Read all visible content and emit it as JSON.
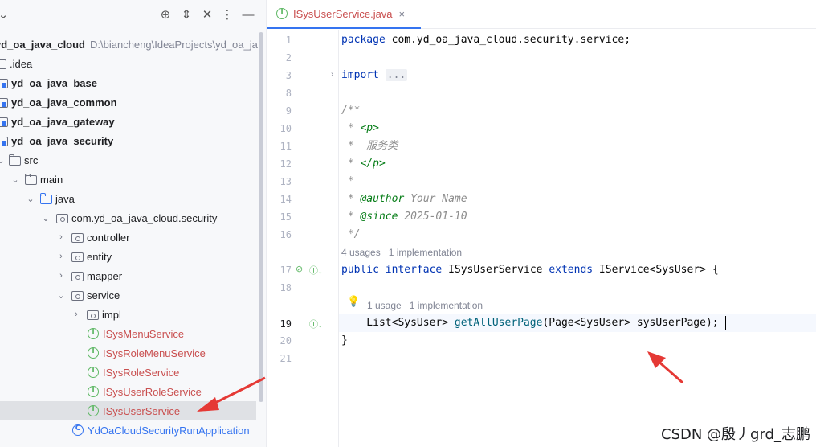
{
  "project_panel": {
    "toolbar_icons": [
      "locate-icon",
      "expand-collapse-icon",
      "collapse-all-icon",
      "more-icon",
      "minimize-icon"
    ],
    "root": {
      "name": "yd_oa_java_cloud",
      "path": "D:\\biancheng\\IdeaProjects\\yd_oa_ja"
    },
    "items": [
      {
        "label": ".idea"
      },
      {
        "label": "yd_oa_java_base"
      },
      {
        "label": "yd_oa_java_common"
      },
      {
        "label": "yd_oa_java_gateway"
      },
      {
        "label": "yd_oa_java_security"
      },
      {
        "label": "src"
      },
      {
        "label": "main"
      },
      {
        "label": "java"
      },
      {
        "label": "com.yd_oa_java_cloud.security"
      },
      {
        "label": "controller"
      },
      {
        "label": "entity"
      },
      {
        "label": "mapper"
      },
      {
        "label": "service"
      },
      {
        "label": "impl"
      },
      {
        "label": "ISysMenuService"
      },
      {
        "label": "ISysRoleMenuService"
      },
      {
        "label": "ISysRoleService"
      },
      {
        "label": "ISysUserRoleService"
      },
      {
        "label": "ISysUserService"
      },
      {
        "label": "YdOaCloudSecurityRunApplication"
      }
    ]
  },
  "editor": {
    "tab": {
      "label": "ISysUserService.java",
      "close": "×"
    },
    "line_numbers": [
      "1",
      "2",
      "3",
      "8",
      "9",
      "10",
      "11",
      "12",
      "13",
      "14",
      "15",
      "16",
      "17",
      "18",
      "19",
      "20",
      "21"
    ],
    "code": {
      "l1_kw": "package",
      "l1_rest": " com.yd_oa_java_cloud.security.service;",
      "l3_kw": "import",
      "l3_fold": "...",
      "l9": "/**",
      "l10_star": " * ",
      "l10_tag": "<p>",
      "l11": " *  服务类",
      "l12_star": " * ",
      "l12_tag": "</p>",
      "l13": " *",
      "l14_star": " * ",
      "l14_tag": "@author",
      "l14_val": " Your Name",
      "l15_star": " * ",
      "l15_tag": "@since",
      "l15_val": " 2025-01-10",
      "l16": " */",
      "l17_kw1": "public",
      "l17_kw2": "interface",
      "l17_name": " ISysUserService ",
      "l17_kw3": "extends",
      "l17_rest": " IService<SysUser> {",
      "l19_type": "    List<SysUser> ",
      "l19_method": "getAllUserPage",
      "l19_rest": "(Page<SysUser> sysUserPage);",
      "l20": "}"
    },
    "hints": {
      "interface_usages": "4 usages",
      "interface_impls": "1 implementation",
      "method_usages": "1 usage",
      "method_impls": "1 implementation"
    }
  },
  "watermark": "CSDN @殷丿grd_志鹏",
  "colors": {
    "accent": "#3574f0",
    "interface": "#5fb865",
    "error_name": "#c94f4f",
    "keyword": "#0033b3",
    "arrow": "#e53935"
  }
}
